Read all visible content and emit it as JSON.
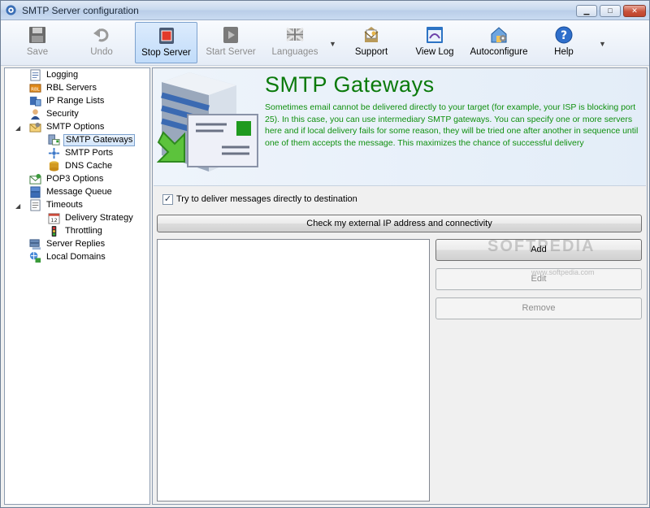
{
  "window": {
    "title": "SMTP Server configuration",
    "icon": "app-gear-icon",
    "controls": {
      "minimize": "minimize-icon",
      "maximize": "maximize-icon",
      "close": "close-icon"
    }
  },
  "toolbar": {
    "items": [
      {
        "label": "Save",
        "icon": "floppy-disk-icon",
        "enabled": false
      },
      {
        "label": "Undo",
        "icon": "undo-arrow-icon",
        "enabled": false
      },
      {
        "label": "Stop Server",
        "icon": "stop-icon",
        "enabled": true,
        "active": true
      },
      {
        "label": "Start Server",
        "icon": "play-icon",
        "enabled": false
      },
      {
        "label": "Languages",
        "icon": "flag-icon",
        "enabled": false
      },
      {
        "label": "Support",
        "icon": "support-envelope-icon",
        "enabled": true
      },
      {
        "label": "View Log",
        "icon": "log-window-icon",
        "enabled": true
      },
      {
        "label": "Autoconfigure",
        "icon": "house-gear-icon",
        "enabled": true
      },
      {
        "label": "Help",
        "icon": "help-icon",
        "enabled": true
      }
    ]
  },
  "tree": {
    "items": [
      {
        "label": "Logging",
        "icon": "log-icon"
      },
      {
        "label": "RBL Servers",
        "icon": "rbl-icon"
      },
      {
        "label": "IP Range Lists",
        "icon": "ip-range-icon"
      },
      {
        "label": "Security",
        "icon": "security-user-icon"
      },
      {
        "label": "SMTP Options",
        "icon": "smtp-options-icon"
      },
      {
        "label": "SMTP Gateways",
        "icon": "gateway-icon"
      },
      {
        "label": "SMTP Ports",
        "icon": "ports-icon"
      },
      {
        "label": "DNS Cache",
        "icon": "dns-cache-icon"
      },
      {
        "label": "POP3 Options",
        "icon": "pop3-icon"
      },
      {
        "label": "Message Queue",
        "icon": "queue-icon"
      },
      {
        "label": "Timeouts",
        "icon": "timeouts-icon"
      },
      {
        "label": "Delivery Strategy",
        "icon": "calendar-icon"
      },
      {
        "label": "Throttling",
        "icon": "traffic-light-icon"
      },
      {
        "label": "Server Replies",
        "icon": "server-replies-icon"
      },
      {
        "label": "Local Domains",
        "icon": "local-domains-icon"
      }
    ],
    "selected": "SMTP Gateways"
  },
  "page": {
    "title": "SMTP Gateways",
    "description": "Sometimes email cannot be delivered directly to your target (for example, your ISP is blocking port 25). In this case, you can use intermediary SMTP gateways. You can specify one or more servers here and if local delivery fails for some reason, they will be tried one after another in sequence until one of them accepts the message. This maximizes the chance of successful delivery",
    "checkbox_label": "Try to deliver messages directly to destination",
    "checkbox_checked": true,
    "check_button": "Check my external IP address and connectivity",
    "add_button": "Add",
    "edit_button": "Edit",
    "remove_button": "Remove"
  },
  "watermark": {
    "text": "SOFTPEDIA",
    "sub": "www.softpedia.com"
  },
  "colors": {
    "title_green": "#0b7a0b",
    "desc_green": "#10900f",
    "selection_blue": "#7da2ce"
  }
}
